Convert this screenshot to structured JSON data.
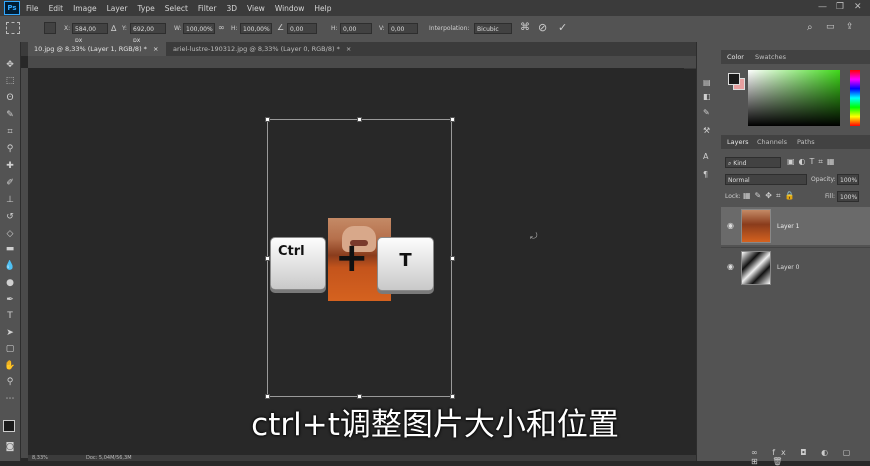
{
  "app": {
    "logo": "Ps"
  },
  "menu": [
    "File",
    "Edit",
    "Image",
    "Layer",
    "Type",
    "Select",
    "Filter",
    "3D",
    "View",
    "Window",
    "Help"
  ],
  "options": {
    "x_label": "X:",
    "x_value": "584,00 px",
    "y_label": "Y:",
    "y_value": "692,00 px",
    "w_label": "W:",
    "w_value": "100,00%",
    "h_label": "H:",
    "h_value": "100,00%",
    "angle_value": "0,00",
    "hskew_label": "H:",
    "hskew_value": "0,00",
    "vskew_label": "V:",
    "vskew_value": "0,00",
    "interp_label": "Interpolation:",
    "interp_value": "Bicubic"
  },
  "tabs": [
    {
      "label": "10.jpg @ 8,33% (Layer 1, RGB/8) *"
    },
    {
      "label": "ariel-lustre-190312.jpg @ 8,33% (Layer 0, RGB/8) *"
    }
  ],
  "canvas": {
    "keys": {
      "ctrl": "Ctrl",
      "plus": "+",
      "t": "T"
    },
    "caption": "ctrl+t调整图片大小和位置"
  },
  "status": {
    "zoom": "8,33%",
    "doc": "Doc: 5,04M/56,3M"
  },
  "color_panel": {
    "tab_color": "Color",
    "tab_swatches": "Swatches"
  },
  "layers_panel": {
    "tab_layers": "Layers",
    "tab_channels": "Channels",
    "tab_paths": "Paths",
    "kind": "Kind",
    "blend": "Normal",
    "opacity_label": "Opacity:",
    "opacity_value": "100%",
    "lock_label": "Lock:",
    "fill_label": "Fill:",
    "fill_value": "100%",
    "layers": [
      {
        "name": "Layer 1"
      },
      {
        "name": "Layer 0"
      }
    ]
  },
  "colors": {
    "fg": "#1a1a1a",
    "bg": "#e8a0a0",
    "hue": "#3fd81a"
  }
}
